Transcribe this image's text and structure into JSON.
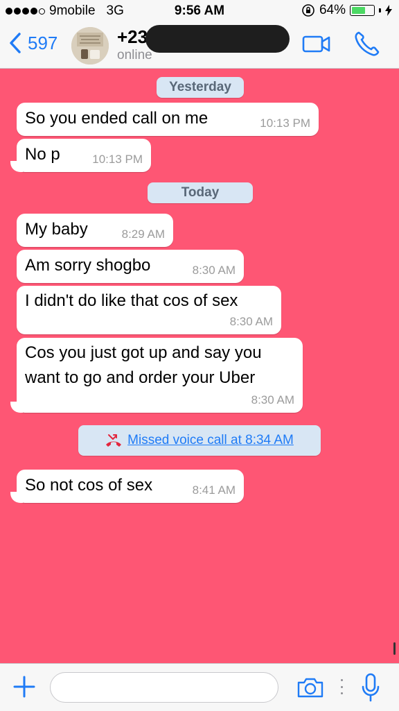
{
  "status_bar": {
    "carrier": "9mobile",
    "network": "3G",
    "time": "9:56 AM",
    "battery": "64%",
    "battery_level": 0.64
  },
  "header": {
    "back_count": "597",
    "contact_name": "+23",
    "contact_status": "online"
  },
  "colors": {
    "chat_background": "#fe5674",
    "accent": "#1f7bf6",
    "missed_call_icon": "#e3263d"
  },
  "chat": {
    "dates": [
      "Yesterday",
      "Today"
    ],
    "messages": [
      {
        "text": "So you ended call on me",
        "time": "10:13 PM"
      },
      {
        "text": "No p",
        "time": "10:13 PM"
      },
      {
        "text": "My baby",
        "time": "8:29 AM"
      },
      {
        "text": "Am sorry shogbo",
        "time": "8:30 AM"
      },
      {
        "text": "I didn't do like that cos of sex",
        "time": "8:30 AM"
      },
      {
        "text_line1": "Cos you just got up and say you",
        "text_line2": "want to go and order your Uber",
        "time": "8:30 AM"
      },
      {
        "text": "So not cos of sex",
        "time": "8:41 AM"
      }
    ],
    "missed_call": "Missed voice call at 8:34 AM"
  },
  "input": {
    "placeholder": "",
    "value": ""
  }
}
